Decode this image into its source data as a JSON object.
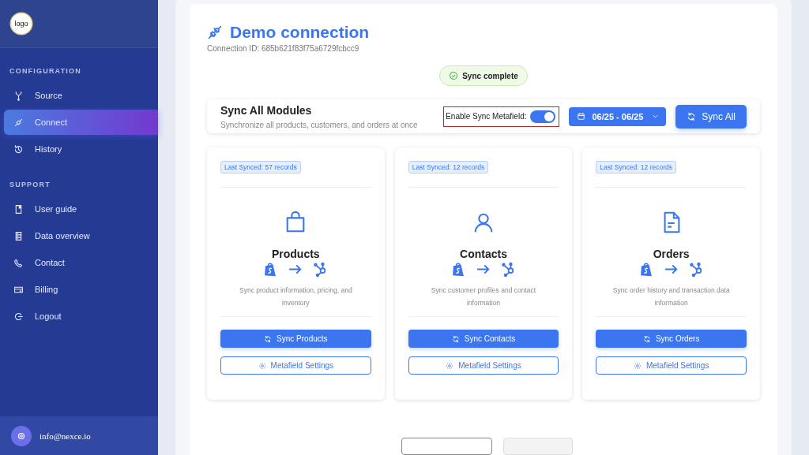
{
  "sidebar": {
    "logo": "logo",
    "sections": [
      {
        "title": "CONFIGURATION",
        "items": [
          {
            "label": "Source",
            "kind": "source",
            "selected": false
          },
          {
            "label": "Connect",
            "kind": "connect",
            "selected": true
          },
          {
            "label": "History",
            "kind": "history",
            "selected": false
          }
        ]
      },
      {
        "title": "SUPPORT",
        "items": [
          {
            "label": "User guide",
            "kind": "guide",
            "selected": false
          },
          {
            "label": "Data overview",
            "kind": "data",
            "selected": false
          },
          {
            "label": "Contact",
            "kind": "contact",
            "selected": false
          },
          {
            "label": "Billing",
            "kind": "billing",
            "selected": false
          },
          {
            "label": "Logout",
            "kind": "logout",
            "selected": false
          }
        ]
      }
    ],
    "user": {
      "email": "info@nexce.io"
    }
  },
  "header": {
    "title": "Demo connection",
    "connection_id": "Connection ID: 685b621f83f75a6729fcbcc9"
  },
  "status_badge": "Sync complete",
  "sync_all": {
    "title": "Sync All Modules",
    "subtitle": "Synchronize all products, customers, and orders at once",
    "metafield_label": "Enable Sync Metafield:",
    "metafield_on": true,
    "date_range": "06/25 - 06/25",
    "button": "Sync All"
  },
  "modules": [
    {
      "kind": "products",
      "badge": "Last Synced: 57 records",
      "title": "Products",
      "description": "Sync product information, pricing, and inventory",
      "sync_button": "Sync Products",
      "settings_button": "Metafield Settings"
    },
    {
      "kind": "contacts",
      "badge": "Last Synced: 12 records",
      "title": "Contacts",
      "description": "Sync customer profiles and contact information",
      "sync_button": "Sync Contacts",
      "settings_button": "Metafield Settings"
    },
    {
      "kind": "orders",
      "badge": "Last Synced: 12 records",
      "title": "Orders",
      "description": "Sync order history and transaction data information",
      "sync_button": "Sync Orders",
      "settings_button": "Metafield Settings"
    }
  ]
}
